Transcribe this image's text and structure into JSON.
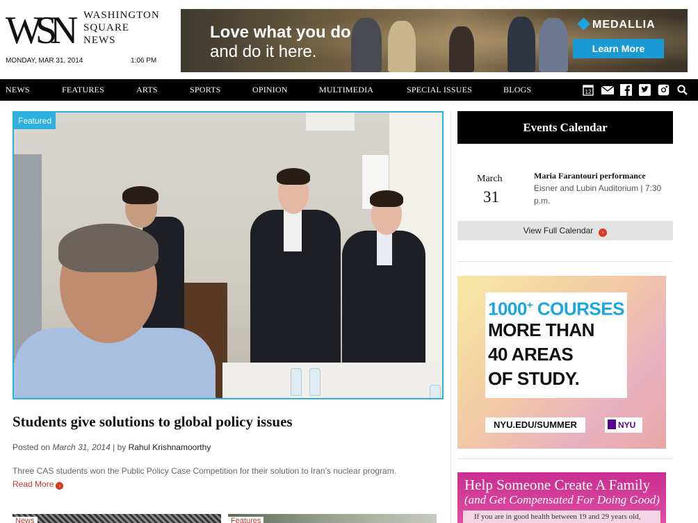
{
  "masthead": {
    "logo_mark": "WSN",
    "logo_lines": [
      "WASHINGTON",
      "SQUARE",
      "NEWS"
    ],
    "date": "MONDAY, MAR 31, 2014",
    "time": "1:06 PM"
  },
  "banner_ad": {
    "headline": "Love what you do",
    "subline": "and do it here.",
    "brand": "MEDALLIA",
    "cta": "Learn More"
  },
  "nav": {
    "items": [
      "NEWS",
      "FEATURES",
      "ARTS",
      "SPORTS",
      "OPINION",
      "MULTIMEDIA",
      "SPECIAL ISSUES",
      "BLOGS"
    ],
    "icons": [
      "calendar-icon",
      "mail-icon",
      "facebook-icon",
      "twitter-icon",
      "instagram-icon",
      "search-icon"
    ],
    "calendar_day": "12"
  },
  "featured": {
    "tag": "Featured",
    "title": "Students give solutions to global policy issues",
    "posted_prefix": "Posted on",
    "date": "March 31, 2014",
    "by_text": "| by",
    "author": "Rahul Krishnamoorthy",
    "summary": "Three CAS students won the Public Policy Case Competition for their solution to Iran’s nuclear program.",
    "read_more": "Read More"
  },
  "more_stories": [
    {
      "tag": "News"
    },
    {
      "tag": "Features"
    }
  ],
  "events": {
    "header": "Events Calendar",
    "month": "March",
    "day": "31",
    "title": "Maria Farantouri performance",
    "venue": "Eisner and Lubin Auditorium | 7:30 p.m.",
    "view_full": "View Full Calendar"
  },
  "nyu_ad": {
    "line1": "1000",
    "line1_sup": "+",
    "line1_rest": " COURSES",
    "line2": "MORE THAN",
    "line3": "40 AREAS",
    "line4": "OF STUDY.",
    "url": "NYU.EDU/SUMMER",
    "logo": "NYU",
    "accent": "#1ba6e2"
  },
  "family_ad": {
    "headline": "Help Someone Create A Family",
    "subline": "(and Get Compensated For Doing Good)",
    "body": "If you are in good health between 19 and 29 years old,"
  }
}
